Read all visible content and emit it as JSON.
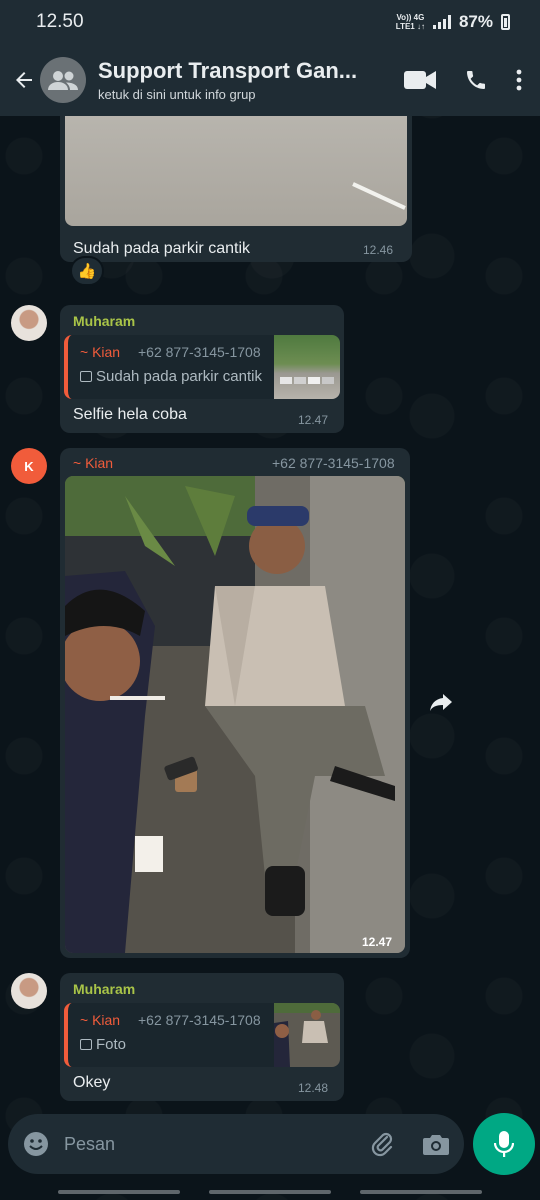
{
  "status": {
    "time": "12.50",
    "network_top": "Vo)) 4G",
    "network_bottom": "LTE1 ↓↑",
    "battery": "87%"
  },
  "header": {
    "title": "Support Transport Gan...",
    "subtitle": "ketuk di sini untuk info grup"
  },
  "messages": [
    {
      "text": "Sudah pada parkir cantik",
      "time": "12.46",
      "reaction": "👍"
    },
    {
      "sender": "Muharam",
      "quote_sender": "~ Kian",
      "quote_phone": "+62 877-3145-1708",
      "quote_text": "Sudah pada parkir cantik",
      "text": "Selfie hela coba",
      "time": "12.47"
    },
    {
      "avatar_letter": "K",
      "sender": "~ Kian",
      "phone": "+62 877-3145-1708",
      "time": "12.47"
    },
    {
      "sender": "Muharam",
      "quote_sender": "~ Kian",
      "quote_phone": "+62 877-3145-1708",
      "quote_text": "Foto",
      "text": "Okey",
      "time": "12.48"
    }
  ],
  "input": {
    "placeholder": "Pesan"
  },
  "colors": {
    "background": "#0b141a",
    "bar": "#1f2c34",
    "bubble": "#202c33",
    "accent_green": "#00a884",
    "name_green": "#a9c448",
    "name_orange": "#f15c3b"
  }
}
